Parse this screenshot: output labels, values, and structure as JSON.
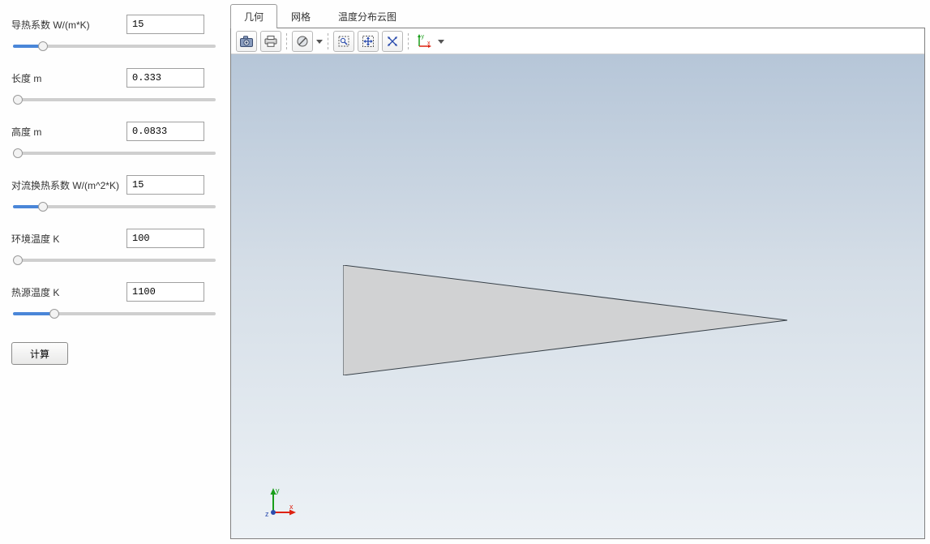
{
  "params": [
    {
      "label": "导热系数 W/(m*K)",
      "value": "15",
      "fill": 13
    },
    {
      "label": "长度 m",
      "value": "0.333",
      "fill": 0
    },
    {
      "label": "高度 m",
      "value": "0.0833",
      "fill": 0
    },
    {
      "label": "对流换热系数 W/(m^2*K)",
      "value": "15",
      "fill": 13
    },
    {
      "label": "环境温度 K",
      "value": "100",
      "fill": 0
    },
    {
      "label": "热源温度 K",
      "value": "1100",
      "fill": 19
    }
  ],
  "compute_label": "计算",
  "tabs": [
    {
      "label": "几何",
      "active": true
    },
    {
      "label": "网格",
      "active": false
    },
    {
      "label": "温度分布云图",
      "active": false
    }
  ],
  "triad": {
    "x_label": "x",
    "y_label": "y",
    "z_label": "z"
  },
  "toolbar_triad": {
    "x_label": "x",
    "y_label": "y"
  },
  "colors": {
    "accent": "#4a86d8",
    "border": "#808080",
    "triangle_fill": "#d1d2d3"
  }
}
